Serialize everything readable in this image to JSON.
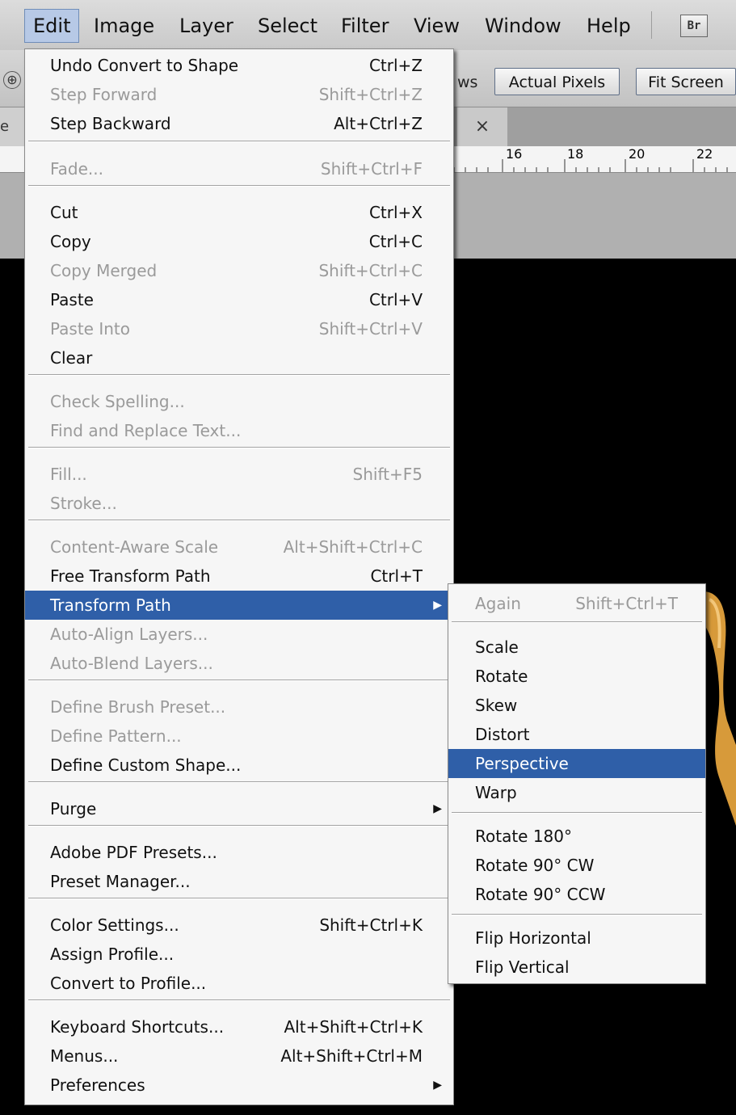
{
  "menubar": {
    "items": [
      "Edit",
      "Image",
      "Layer",
      "Select",
      "Filter",
      "View",
      "Window",
      "Help"
    ],
    "bridge_badge": "Br"
  },
  "optionsbar": {
    "fragment": "ws",
    "actual_pixels": "Actual Pixels",
    "fit_screen": "Fit Screen"
  },
  "tabbar": {
    "left_fragment": "e",
    "close_glyph": "×"
  },
  "ruler": {
    "labels": [
      "16",
      "18",
      "20",
      "22"
    ]
  },
  "edit_menu": {
    "items": [
      {
        "label": "Undo Convert to Shape",
        "shortcut": "Ctrl+Z",
        "disabled": false
      },
      {
        "label": "Step Forward",
        "shortcut": "Shift+Ctrl+Z",
        "disabled": true
      },
      {
        "label": "Step Backward",
        "shortcut": "Alt+Ctrl+Z",
        "disabled": false
      },
      {
        "label": "Fade...",
        "shortcut": "Shift+Ctrl+F",
        "disabled": true
      },
      {
        "label": "Cut",
        "shortcut": "Ctrl+X",
        "disabled": false
      },
      {
        "label": "Copy",
        "shortcut": "Ctrl+C",
        "disabled": false
      },
      {
        "label": "Copy Merged",
        "shortcut": "Shift+Ctrl+C",
        "disabled": true
      },
      {
        "label": "Paste",
        "shortcut": "Ctrl+V",
        "disabled": false
      },
      {
        "label": "Paste Into",
        "shortcut": "Shift+Ctrl+V",
        "disabled": true
      },
      {
        "label": "Clear",
        "shortcut": "",
        "disabled": false
      },
      {
        "label": "Check Spelling...",
        "shortcut": "",
        "disabled": true
      },
      {
        "label": "Find and Replace Text...",
        "shortcut": "",
        "disabled": true
      },
      {
        "label": "Fill...",
        "shortcut": "Shift+F5",
        "disabled": true
      },
      {
        "label": "Stroke...",
        "shortcut": "",
        "disabled": true
      },
      {
        "label": "Content-Aware Scale",
        "shortcut": "Alt+Shift+Ctrl+C",
        "disabled": true
      },
      {
        "label": "Free Transform Path",
        "shortcut": "Ctrl+T",
        "disabled": false
      },
      {
        "label": "Transform Path",
        "shortcut": "",
        "disabled": false,
        "selected": true,
        "submenu": true
      },
      {
        "label": "Auto-Align Layers...",
        "shortcut": "",
        "disabled": true
      },
      {
        "label": "Auto-Blend Layers...",
        "shortcut": "",
        "disabled": true
      },
      {
        "label": "Define Brush Preset...",
        "shortcut": "",
        "disabled": true
      },
      {
        "label": "Define Pattern...",
        "shortcut": "",
        "disabled": true
      },
      {
        "label": "Define Custom Shape...",
        "shortcut": "",
        "disabled": false
      },
      {
        "label": "Purge",
        "shortcut": "",
        "disabled": false,
        "submenu": true
      },
      {
        "label": "Adobe PDF Presets...",
        "shortcut": "",
        "disabled": false
      },
      {
        "label": "Preset Manager...",
        "shortcut": "",
        "disabled": false
      },
      {
        "label": "Color Settings...",
        "shortcut": "Shift+Ctrl+K",
        "disabled": false
      },
      {
        "label": "Assign Profile...",
        "shortcut": "",
        "disabled": false
      },
      {
        "label": "Convert to Profile...",
        "shortcut": "",
        "disabled": false
      },
      {
        "label": "Keyboard Shortcuts...",
        "shortcut": "Alt+Shift+Ctrl+K",
        "disabled": false
      },
      {
        "label": "Menus...",
        "shortcut": "Alt+Shift+Ctrl+M",
        "disabled": false
      },
      {
        "label": "Preferences",
        "shortcut": "",
        "disabled": false,
        "submenu": true
      }
    ]
  },
  "transform_submenu": {
    "items": [
      {
        "label": "Again",
        "shortcut": "Shift+Ctrl+T",
        "disabled": true
      },
      {
        "label": "Scale",
        "shortcut": "",
        "disabled": false
      },
      {
        "label": "Rotate",
        "shortcut": "",
        "disabled": false
      },
      {
        "label": "Skew",
        "shortcut": "",
        "disabled": false
      },
      {
        "label": "Distort",
        "shortcut": "",
        "disabled": false
      },
      {
        "label": "Perspective",
        "shortcut": "",
        "disabled": false,
        "selected": true
      },
      {
        "label": "Warp",
        "shortcut": "",
        "disabled": false
      },
      {
        "label": "Rotate 180°",
        "shortcut": "",
        "disabled": false
      },
      {
        "label": "Rotate 90° CW",
        "shortcut": "",
        "disabled": false
      },
      {
        "label": "Rotate 90° CCW",
        "shortcut": "",
        "disabled": false
      },
      {
        "label": "Flip Horizontal",
        "shortcut": "",
        "disabled": false
      },
      {
        "label": "Flip Vertical",
        "shortcut": "",
        "disabled": false
      }
    ]
  },
  "colors": {
    "highlight": "#2f5fa8",
    "menu_bg": "#f6f6f6",
    "disabled_text": "#9a9a9a",
    "canvas": "#000000"
  }
}
